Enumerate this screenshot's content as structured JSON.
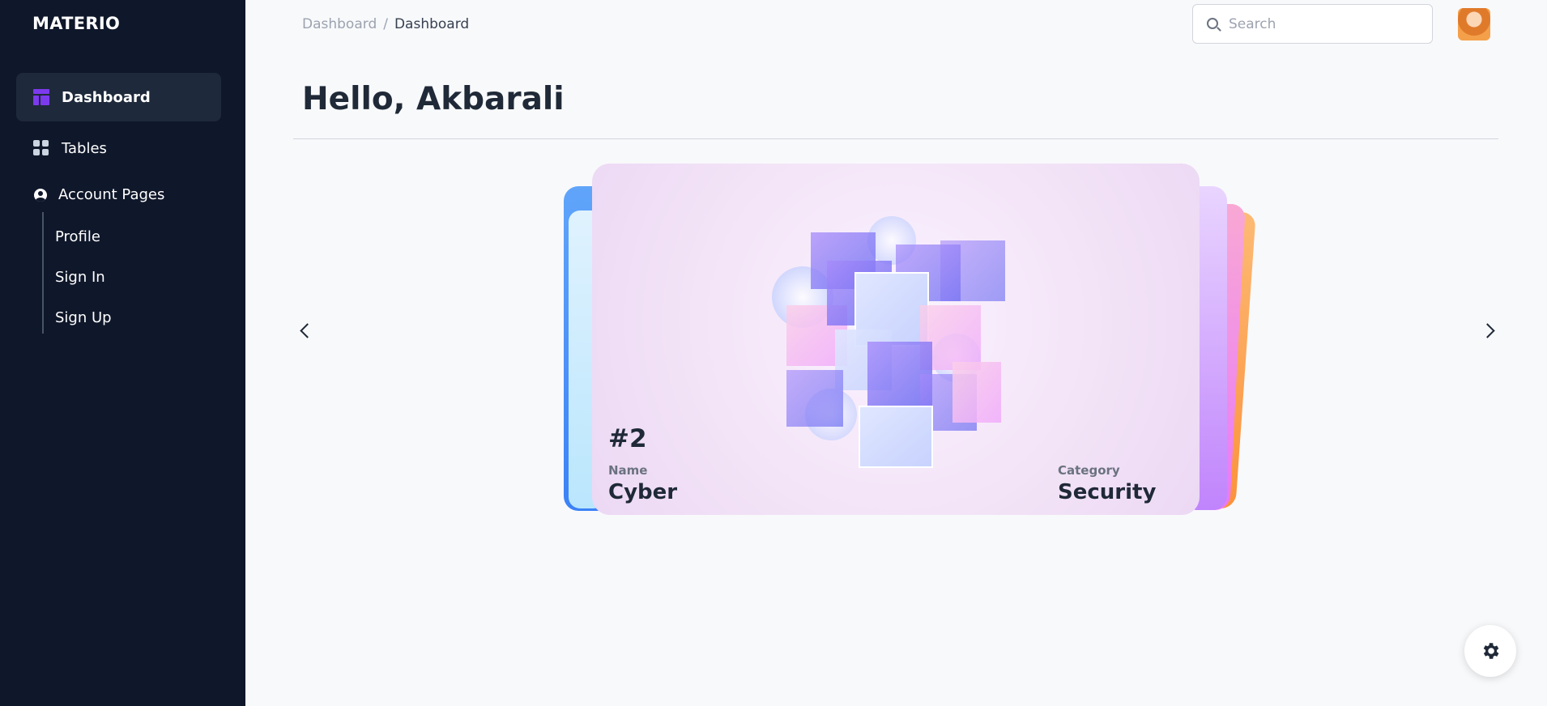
{
  "sidebar": {
    "brand": "MATERIO",
    "items": [
      {
        "label": "Dashboard",
        "icon": "dashboard-icon",
        "active": true
      },
      {
        "label": "Tables",
        "icon": "grid-icon",
        "active": false
      }
    ],
    "account": {
      "label": "Account Pages",
      "icon": "user-circle-icon",
      "children": [
        "Profile",
        "Sign In",
        "Sign Up"
      ]
    }
  },
  "header": {
    "breadcrumb": [
      "Dashboard",
      "Dashboard"
    ],
    "separator": "/",
    "search": {
      "placeholder": "Search",
      "value": ""
    },
    "avatar_icon": "avatar"
  },
  "main": {
    "title": "Hello, Akbarali",
    "carousel": {
      "active_card": {
        "rank": "#2",
        "name_label": "Name",
        "name_value": "Cyber",
        "category_label": "Category",
        "category_value": "Security"
      }
    }
  },
  "colors": {
    "sidebar_bg": "#0f172a",
    "accent": "#7c3aed",
    "card_bg": "#f3e4f7"
  },
  "floating": {
    "settings_icon": "gear-icon"
  }
}
